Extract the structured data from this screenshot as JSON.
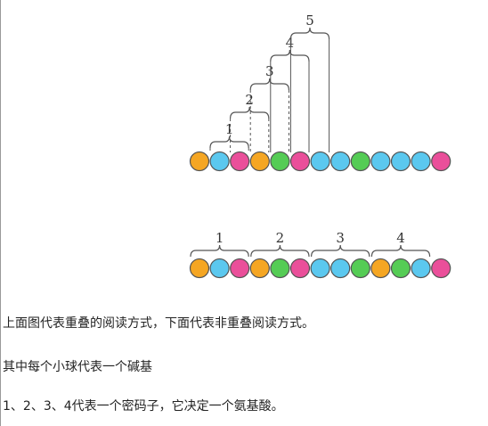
{
  "figure": {
    "colors": {
      "orange": "#f5a623",
      "blue": "#5bc8ef",
      "pink": "#ea4f9a",
      "green": "#55cc55",
      "outline": "#555555",
      "bracket": "#555555"
    },
    "top_row": [
      "orange",
      "blue",
      "pink",
      "orange",
      "green",
      "pink",
      "blue",
      "blue",
      "green",
      "blue",
      "blue",
      "blue",
      "pink"
    ],
    "bottom_row": [
      "orange",
      "blue",
      "pink",
      "orange",
      "green",
      "pink",
      "blue",
      "blue",
      "green",
      "orange",
      "green",
      "blue",
      "pink"
    ],
    "overlapping_labels": [
      "1",
      "2",
      "3",
      "4",
      "5"
    ],
    "non_overlapping_labels": [
      "1",
      "2",
      "3",
      "4"
    ]
  },
  "captions": {
    "line1": "上面图代表重叠的阅读方式，下面代表非重叠阅读方式。",
    "line2": "其中每个小球代表一个碱基",
    "line3": "1、2、3、4代表一个密码子，它决定一个氨基酸。"
  }
}
